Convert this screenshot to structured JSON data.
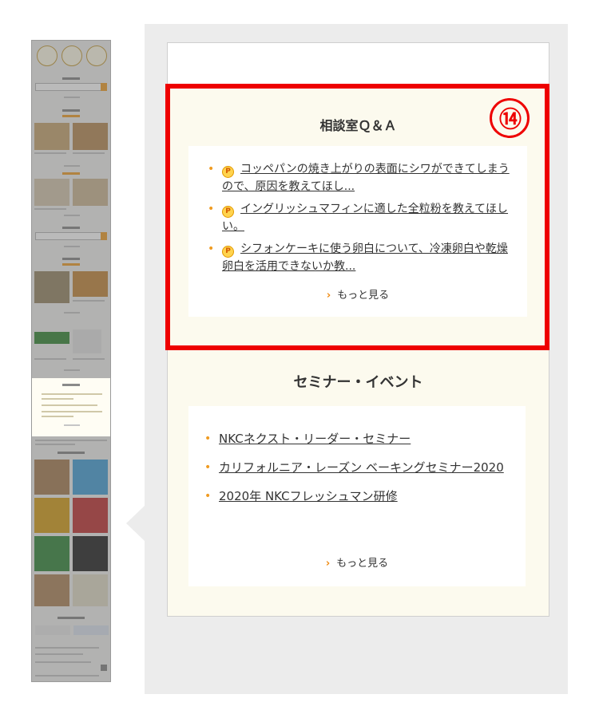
{
  "consultation": {
    "title": "相談室Ｑ＆Ａ",
    "badge": "⑭",
    "items": [
      {
        "icon": "P",
        "text": "コッペパンの焼き上がりの表面にシワができてしまうので、原因を教えてほし..."
      },
      {
        "icon": "P",
        "text": "イングリッシュマフィンに適した全粒粉を教えてほしい。"
      },
      {
        "icon": "P",
        "text": "シフォンケーキに使う卵白について、冷凍卵白や乾燥卵白を活用できないか教..."
      }
    ],
    "more_label": "もっと見る"
  },
  "seminar": {
    "title": "セミナー・イベント",
    "items": [
      {
        "text": "NKCネクスト・リーダー・セミナー"
      },
      {
        "text": "カリフォルニア・レーズン ベーキングセミナー2020"
      },
      {
        "text": "2020年 NKCフレッシュマン研修"
      }
    ],
    "more_label": "もっと見る"
  },
  "colors": {
    "highlight": "#ee0000",
    "accent": "#f09b21",
    "section_bg": "#fcfaee"
  }
}
